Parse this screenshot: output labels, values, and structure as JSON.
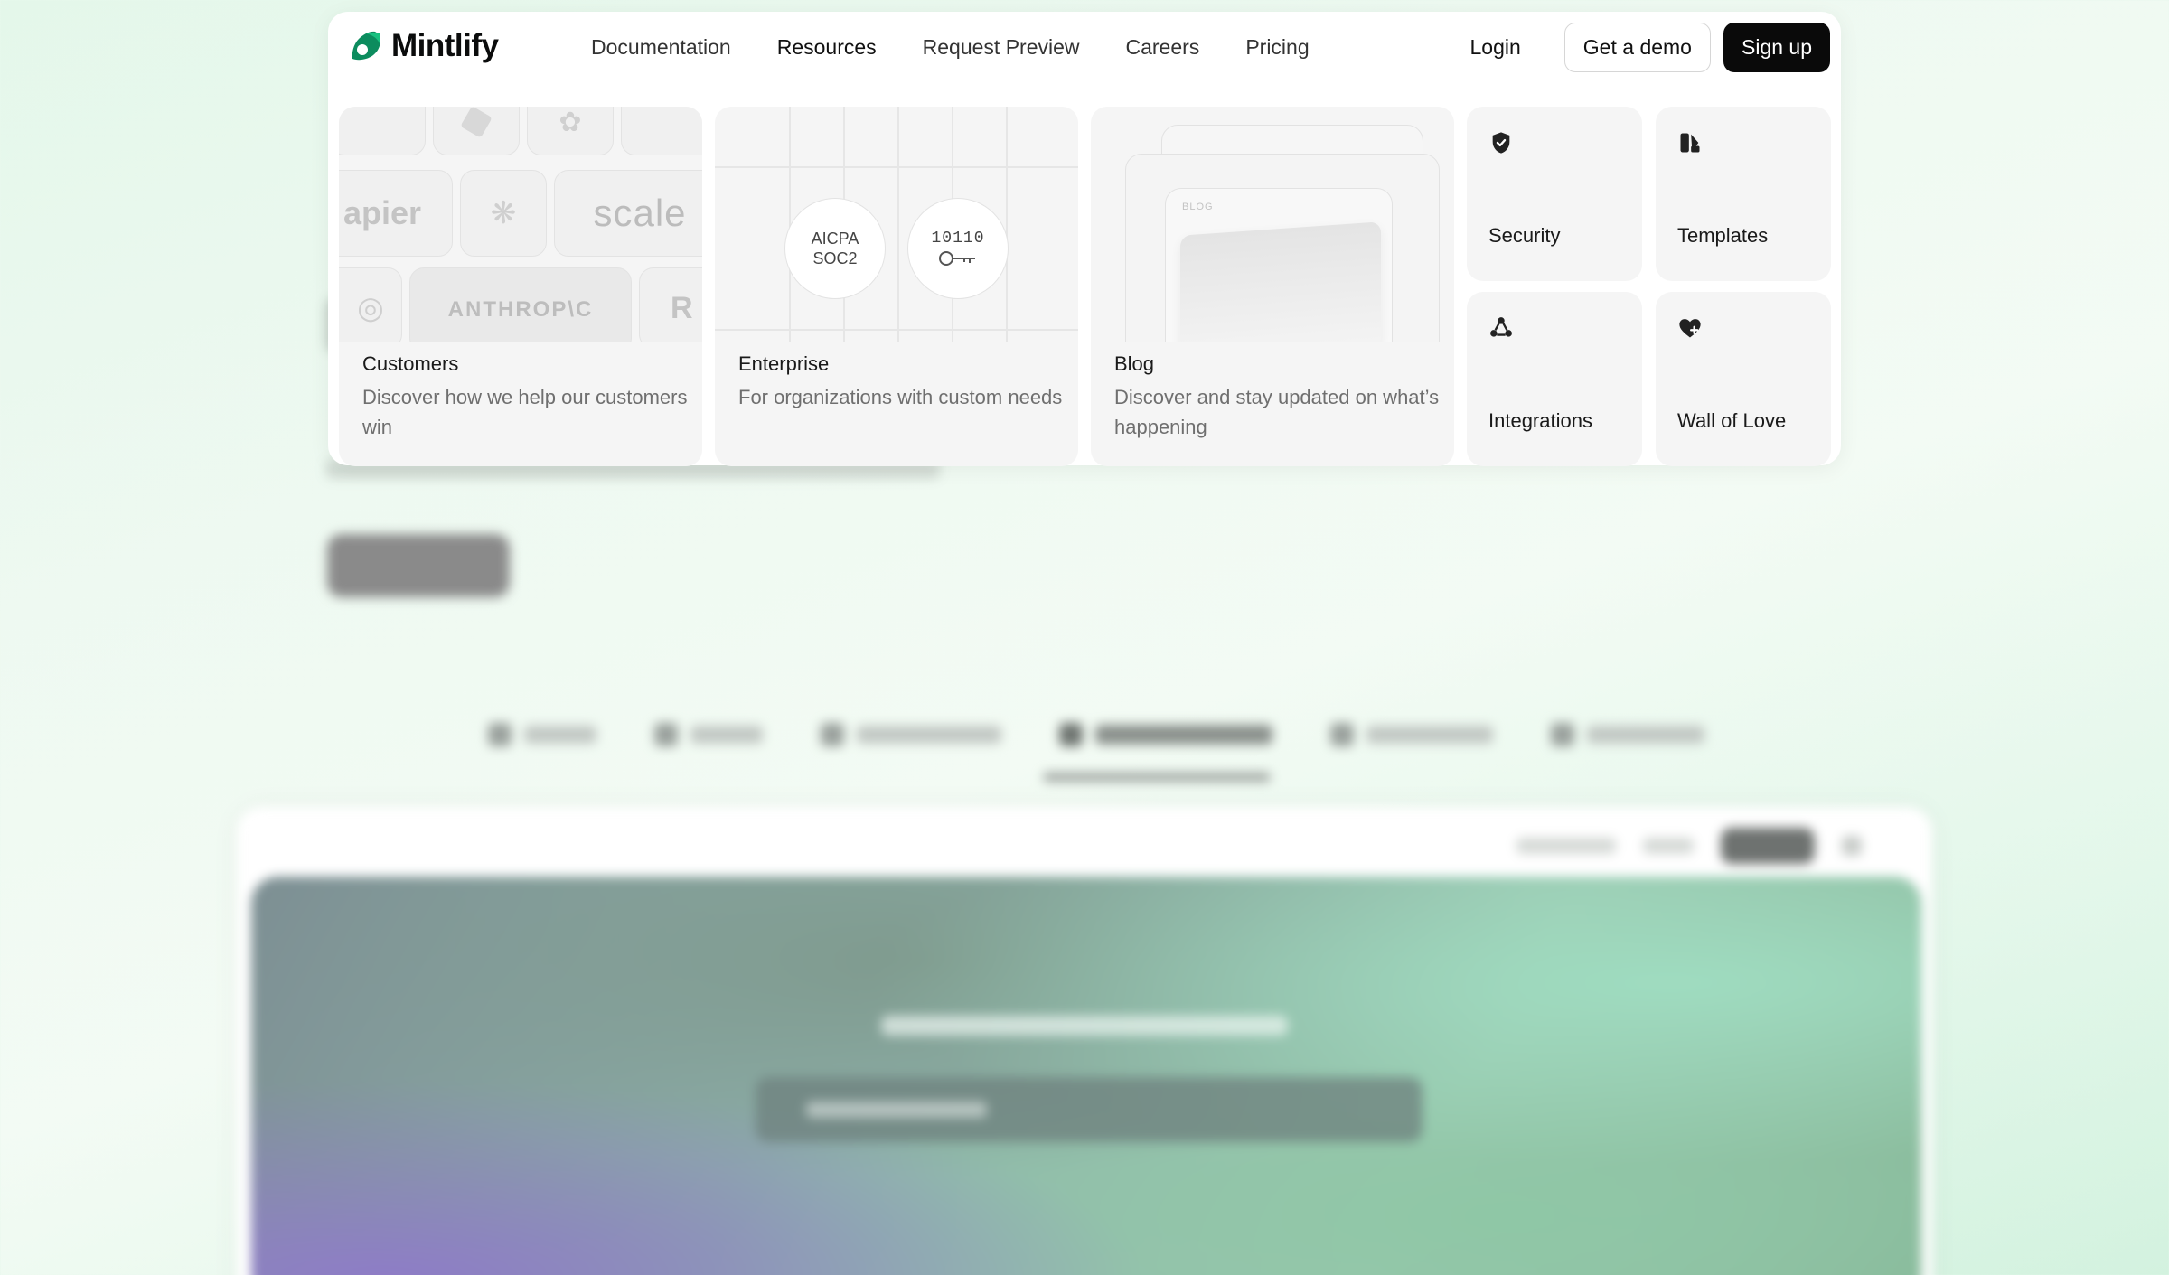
{
  "brand": {
    "name": "Mintlify",
    "accent": "#0c8c5e"
  },
  "nav": {
    "links": [
      "Documentation",
      "Resources",
      "Request Preview",
      "Careers",
      "Pricing"
    ],
    "active_index": 1,
    "login": "Login",
    "demo": "Get a demo",
    "signup": "Sign up"
  },
  "dropdown": {
    "customers": {
      "title": "Customers",
      "description": "Discover how we help our customers win",
      "logos": [
        "apier",
        "scale",
        "ANTHROP\\C",
        "R"
      ]
    },
    "enterprise": {
      "title": "Enterprise",
      "description": "For organizations with custom needs",
      "badge_line1": "AICPA",
      "badge_line2": "SOC2",
      "binary": "10110"
    },
    "blog": {
      "title": "Blog",
      "description": "Discover and stay updated on what’s happening",
      "thumb_label": "BLOG"
    },
    "security": {
      "title": "Security",
      "icon": "shield-check-icon"
    },
    "templates": {
      "title": "Templates",
      "icon": "template-icon"
    },
    "integrations": {
      "title": "Integrations",
      "icon": "integrations-icon"
    },
    "wall_of_love": {
      "title": "Wall of Love",
      "icon": "heart-plus-icon"
    }
  }
}
